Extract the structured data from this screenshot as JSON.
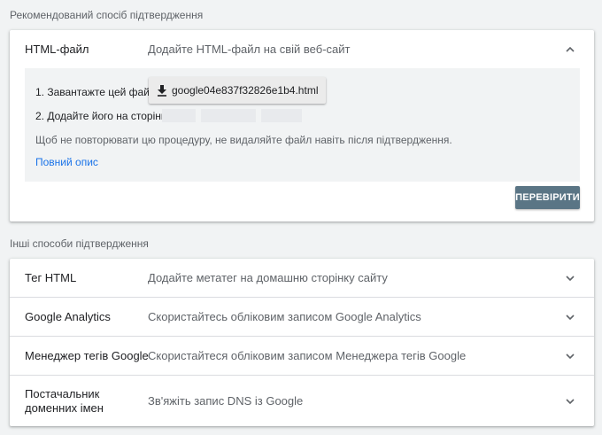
{
  "recommended": {
    "heading": "Рекомендований спосіб підтвердження",
    "method": {
      "title": "HTML-файл",
      "description": "Додайте HTML-файл на свій веб-сайт",
      "expanded": true,
      "chevron": "chevron-up-icon"
    },
    "steps": {
      "step1_label": "1. Завантажте цей файл:",
      "download_filename": "google04e837f32826e1b4.html",
      "download_icon": "download-icon",
      "step2_label": "2. Додайте його на сторінку"
    },
    "hint": "Щоб не повторювати цю процедуру, не видаляйте файл навіть після підтвердження.",
    "full_description_link": "Повний опис",
    "verify_button": "ПЕРЕВІРИТИ"
  },
  "others": {
    "heading": "Інші способи підтвердження",
    "methods": [
      {
        "title": "Тег HTML",
        "description": "Додайте метатег на домашню сторінку сайту",
        "chevron": "chevron-down-icon"
      },
      {
        "title": "Google Analytics",
        "description": "Скористайтесь обліковим записом Google Analytics",
        "chevron": "chevron-down-icon"
      },
      {
        "title": "Менеджер тегів Google",
        "description": "Скористайтеся обліковим записом Менеджера тегів Google",
        "chevron": "chevron-down-icon"
      },
      {
        "title": "Постачальник доменних імен",
        "description": "Зв'яжіть запис DNS із Google",
        "chevron": "chevron-down-icon"
      }
    ]
  },
  "colors": {
    "background": "#f1f3f4",
    "link": "#1a73e8",
    "verify_button_bg": "#5a7585"
  }
}
